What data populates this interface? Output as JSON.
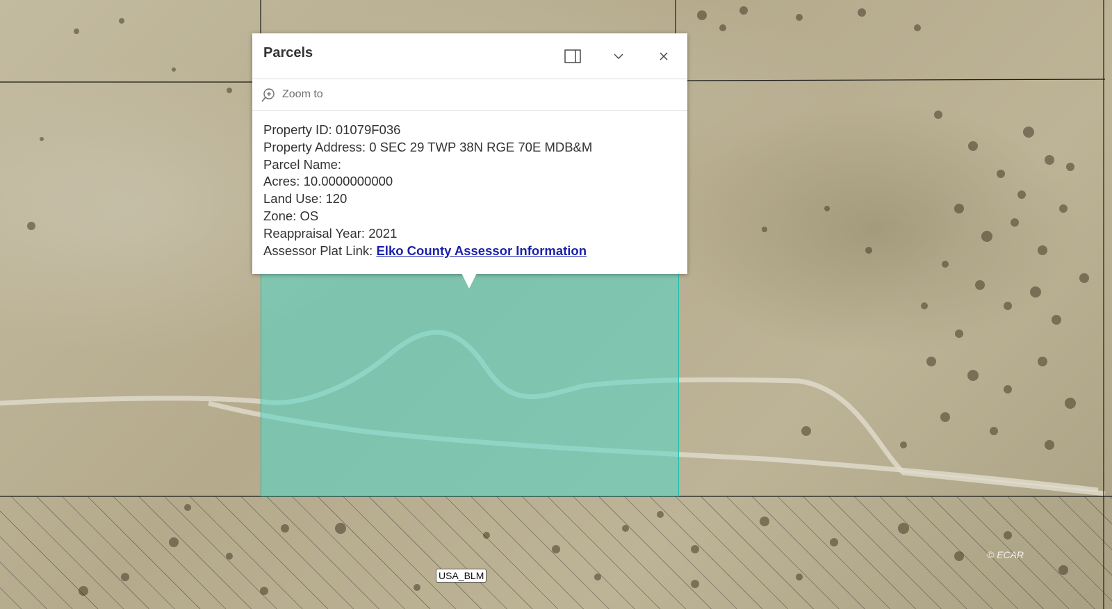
{
  "map": {
    "layer_label": "USA_BLM",
    "attribution": "© ECAR",
    "highlight_color": "#50d7c8"
  },
  "popup": {
    "title": "Parcels",
    "actions": {
      "dock_icon": "dock-side-icon",
      "collapse_icon": "chevron-down-icon",
      "close_icon": "close-icon"
    },
    "zoom_to": {
      "label": "Zoom to",
      "icon": "zoom-in-icon"
    },
    "attributes": [
      {
        "key": "Property ID:",
        "value": "01079F036"
      },
      {
        "key": "Property Address:",
        "value": "0 SEC 29 TWP 38N RGE 70E MDB&M"
      },
      {
        "key": "Parcel Name:",
        "value": ""
      },
      {
        "key": "Acres:",
        "value": "10.0000000000"
      },
      {
        "key": "Land Use:",
        "value": "120"
      },
      {
        "key": "Zone:",
        "value": "OS"
      },
      {
        "key": "Reappraisal Year:",
        "value": "2021"
      }
    ],
    "plat_link": {
      "key": "Assessor Plat Link:",
      "text": "Elko County Assessor Information",
      "color": "#1a22a8"
    }
  }
}
